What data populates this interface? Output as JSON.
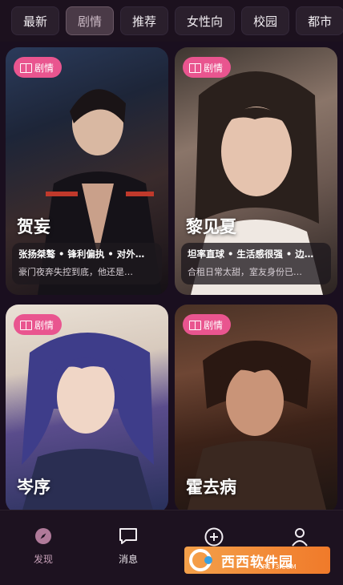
{
  "tabs": [
    "最新",
    "剧情",
    "推荐",
    "女性向",
    "校园",
    "都市"
  ],
  "active_tab": "剧情",
  "cards": [
    {
      "badge": "剧情",
      "name": "贺妄",
      "tags": "张扬桀骜 • 锋利偏执 • 对外…",
      "desc": "豪门夜奔失控到底，他还是…"
    },
    {
      "badge": "剧情",
      "name": "黎见夏",
      "tags": "坦率直球 • 生活感很强 • 边…",
      "desc": "合租日常太甜，室友身份已…"
    },
    {
      "badge": "剧情",
      "name": "岑序",
      "tags": "",
      "desc": ""
    },
    {
      "badge": "剧情",
      "name": "霍去病",
      "tags": "",
      "desc": ""
    }
  ],
  "bottom_nav": [
    {
      "label": "发现",
      "icon": "compass-icon",
      "active": true
    },
    {
      "label": "消息",
      "icon": "chat-icon",
      "active": false
    },
    {
      "label": "创作",
      "icon": "plus-circle-icon",
      "active": false
    },
    {
      "label": "",
      "icon": "user-icon",
      "active": false
    }
  ],
  "watermark": {
    "title": "西西软件园",
    "url": "CR173.COM"
  },
  "colors": {
    "badge": "#e9558f",
    "accent_active": "#c7a0b8",
    "background": "#1a0f1f"
  }
}
